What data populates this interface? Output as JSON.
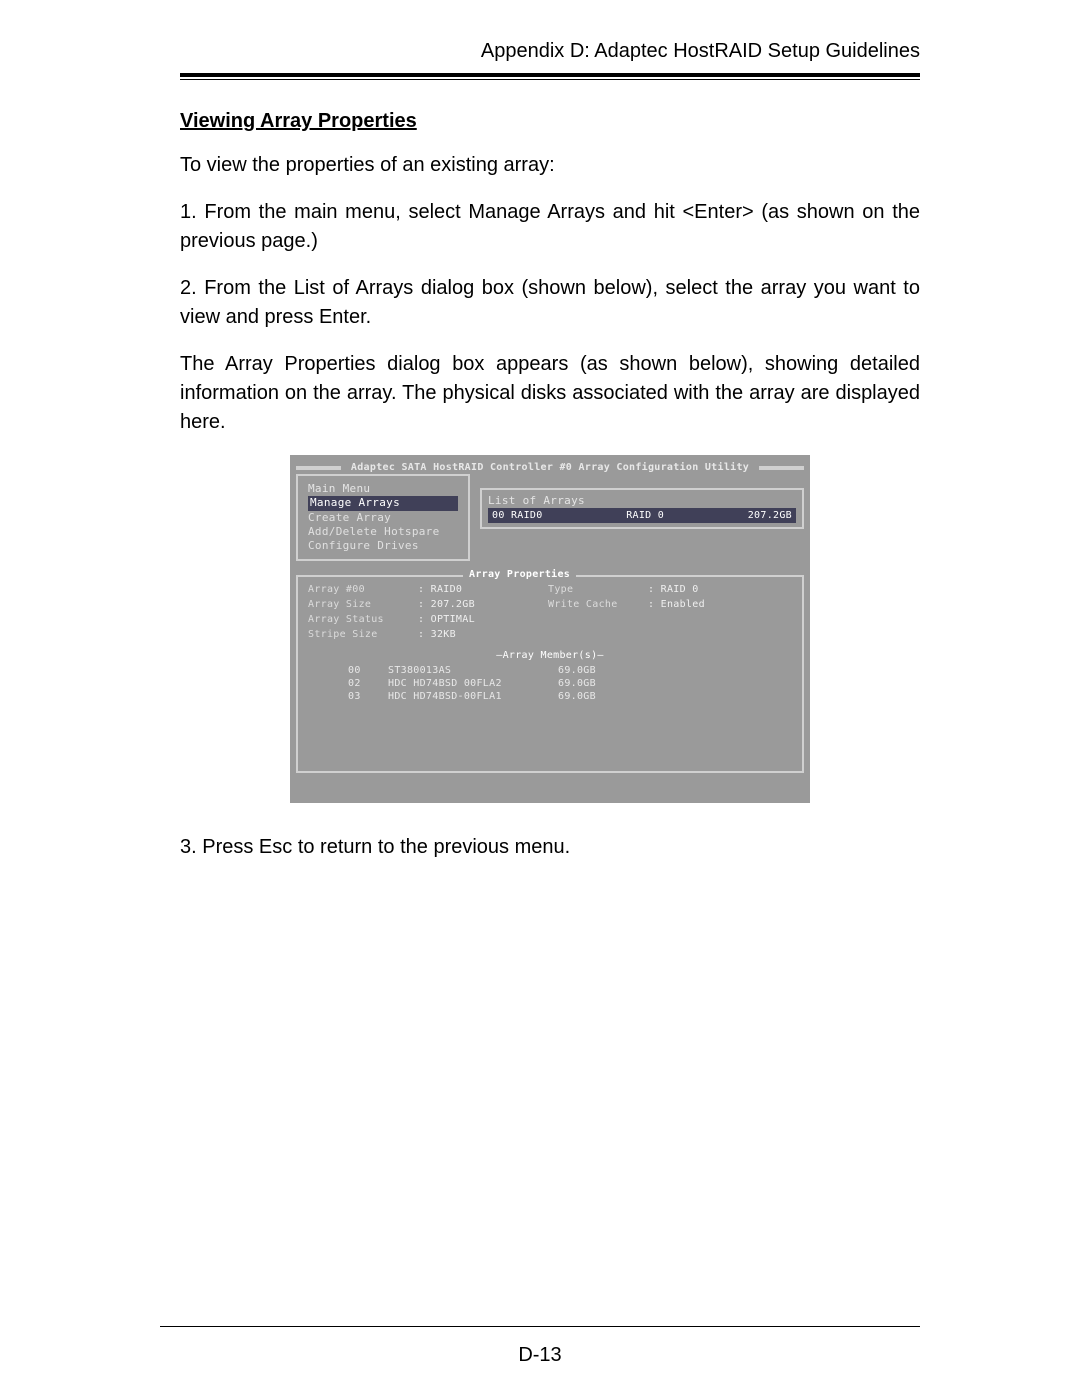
{
  "header": {
    "running": "Appendix D: Adaptec HostRAID Setup Guidelines"
  },
  "section": {
    "title": "Viewing Array Properties",
    "p1": "To view the properties of an existing array:",
    "p2": "1. From the main menu, select Manage Arrays and hit <Enter> (as shown on the previous page.)",
    "p3": "2. From the List of Arrays dialog box (shown below), select the array you want to view and press Enter.",
    "p4": "The Array Properties dialog box appears (as shown below), showing detailed information on the array. The physical disks associated with the array are displayed here.",
    "p5": "3. Press Esc to return to the previous menu."
  },
  "bios": {
    "title": "Adaptec SATA HostRAID Controller #0 Array Configuration Utility",
    "mainMenu": {
      "label": "Main Menu",
      "items": [
        "Manage Arrays",
        "Create Array",
        "Add/Delete Hotspare",
        "Configure Drives"
      ]
    },
    "listOfArrays": {
      "label": "List of Arrays",
      "row": {
        "id": "00 RAID0",
        "type": "RAID 0",
        "size": "207.2GB"
      }
    },
    "arrayProps": {
      "label": "Array Properties",
      "arrayNumLabel": "Array #00",
      "arrayNumVal": ": RAID0",
      "typeLabel": "Type",
      "typeVal": ": RAID 0",
      "sizeLabel": "Array Size",
      "sizeVal": ": 207.2GB",
      "cacheLabel": "Write Cache",
      "cacheVal": ": Enabled",
      "statusLabel": "Array Status",
      "statusVal": ": OPTIMAL",
      "stripeLabel": "Stripe Size",
      "stripeVal": ": 32KB",
      "membersLabel": "—Array Member(s)—",
      "members": [
        {
          "slot": "00",
          "model": "ST380013AS",
          "size": "69.0GB"
        },
        {
          "slot": "02",
          "model": "HDC HD74BSD 00FLA2",
          "size": "69.0GB"
        },
        {
          "slot": "03",
          "model": "HDC HD74BSD-00FLA1",
          "size": "69.0GB"
        }
      ]
    }
  },
  "footer": {
    "pageNum": "D-13"
  }
}
